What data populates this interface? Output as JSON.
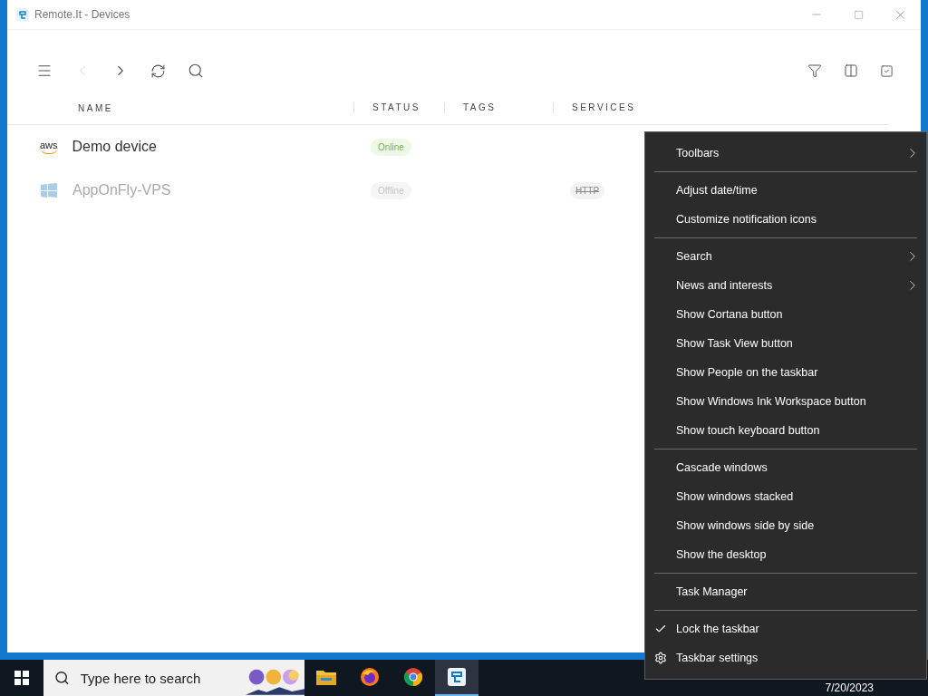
{
  "window": {
    "title": "Remote.It - Devices"
  },
  "table": {
    "columns": [
      "NAME",
      "STATUS",
      "TAGS",
      "SERVICES"
    ],
    "rows": [
      {
        "name": "Demo device",
        "logo": {
          "kind": "aws",
          "text": "aws"
        },
        "online": true,
        "status": "Online",
        "services": []
      },
      {
        "name": "AppOnFly-VPS",
        "logo": {
          "kind": "windows"
        },
        "online": false,
        "status": "Offline",
        "services": [
          "HTTP"
        ]
      }
    ]
  },
  "context_menu": {
    "groups": [
      [
        {
          "label": "Toolbars",
          "kind": "submenu"
        }
      ],
      [
        {
          "label": "Adjust date/time",
          "kind": "item"
        },
        {
          "label": "Customize notification icons",
          "kind": "item"
        }
      ],
      [
        {
          "label": "Search",
          "kind": "submenu"
        },
        {
          "label": "News and interests",
          "kind": "submenu"
        },
        {
          "label": "Show Cortana button",
          "kind": "item"
        },
        {
          "label": "Show Task View button",
          "kind": "item"
        },
        {
          "label": "Show People on the taskbar",
          "kind": "item"
        },
        {
          "label": "Show Windows Ink Workspace button",
          "kind": "item"
        },
        {
          "label": "Show touch keyboard button",
          "kind": "item"
        }
      ],
      [
        {
          "label": "Cascade windows",
          "kind": "item"
        },
        {
          "label": "Show windows stacked",
          "kind": "item"
        },
        {
          "label": "Show windows side by side",
          "kind": "item"
        },
        {
          "label": "Show the desktop",
          "kind": "item"
        }
      ],
      [
        {
          "label": "Task Manager",
          "kind": "item"
        }
      ],
      [
        {
          "label": "Lock the taskbar",
          "kind": "check",
          "checked": true
        },
        {
          "label": "Taskbar settings",
          "kind": "settings"
        }
      ]
    ]
  },
  "taskbar": {
    "search": {
      "placeholder": "Type here to search"
    },
    "apps": [
      {
        "kind": "explorer",
        "selected": false
      },
      {
        "kind": "firefox",
        "selected": false
      },
      {
        "kind": "chrome",
        "selected": false
      },
      {
        "kind": "remoteit",
        "selected": true
      }
    ],
    "date": "7/20/2023"
  }
}
